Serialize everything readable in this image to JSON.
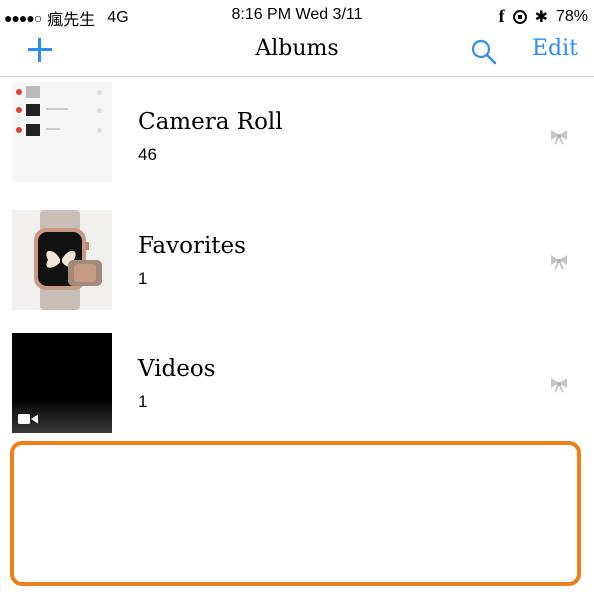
{
  "status_bar": {
    "carrier": "瘋先生",
    "network": "4G",
    "time": "8:16 PM  Wed 3/11",
    "battery": "78%"
  },
  "nav": {
    "title": "Albums",
    "edit_label": "Edit",
    "add_icon": "plus-icon",
    "search_icon": "search-icon"
  },
  "albums": [
    {
      "title": "Camera Roll",
      "count": "46"
    },
    {
      "title": "Favorites",
      "count": "1"
    },
    {
      "title": "Videos",
      "count": "1"
    }
  ],
  "colors": {
    "accent": "#2b8ef0",
    "highlight": "#f07f1a",
    "ribbon": "#c3c6cc"
  }
}
